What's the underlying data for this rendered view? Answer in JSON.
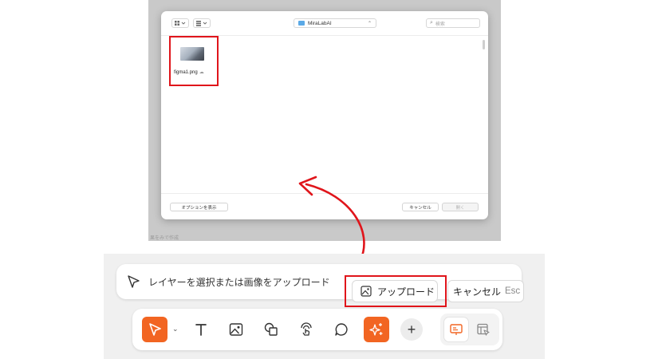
{
  "file_dialog": {
    "folder": "MiraLabAI",
    "search_placeholder": "検索",
    "file_name": "figma1.png",
    "options_label": "オプションを表示",
    "cancel_label": "キャンセル",
    "open_label": "開く",
    "background_text": "果をみで作成"
  },
  "hint_bar": {
    "text": "レイヤーを選択または画像をアップロード",
    "upload_label": "アップロード",
    "cancel_label": "キャンセル",
    "cancel_shortcut": "Esc"
  },
  "toolbar": {
    "tools": [
      "select-pointer-icon",
      "text-icon",
      "image-icon",
      "shapes-icon",
      "hand-touch-icon",
      "comment-icon",
      "ai-sparkle-icon"
    ],
    "add_label": "+",
    "accent_color": "#f26522"
  },
  "annotation_color": "#e0151b"
}
